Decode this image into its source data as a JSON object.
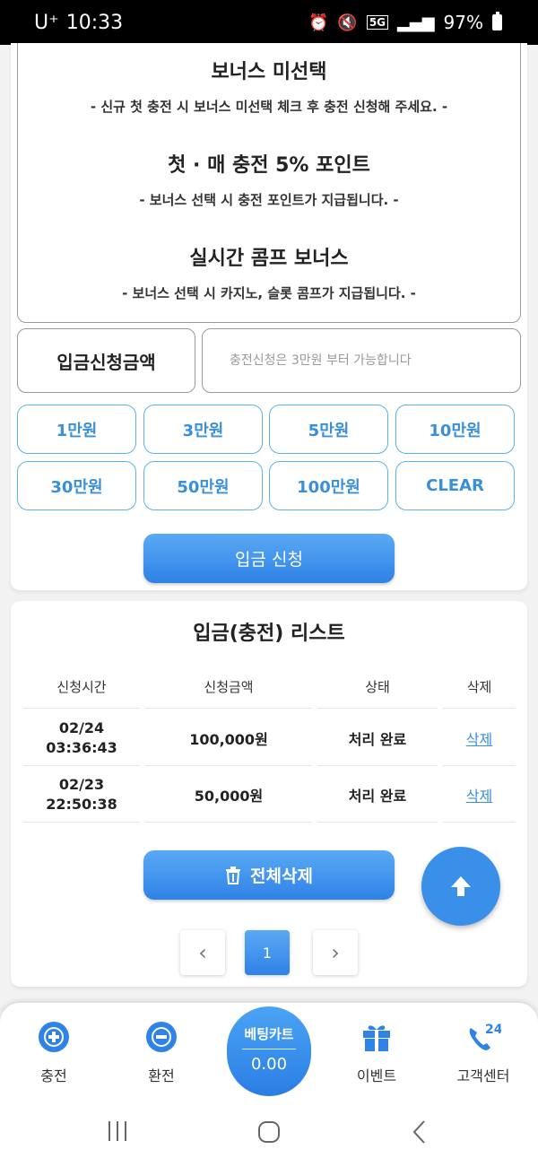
{
  "status_bar": {
    "carrier": "U⁺",
    "time": "10:33",
    "network": "5G",
    "battery": "97%"
  },
  "bonuses": [
    {
      "title": "보너스 미선택",
      "desc": "- 신규 첫 충전 시 보너스 미선택 체크 후 충전 신청해 주세요. -"
    },
    {
      "title": "첫 · 매 충전 5% 포인트",
      "desc": "- 보너스 선택 시 충전 포인트가 지급됩니다. -"
    },
    {
      "title": "실시간 콤프 보너스",
      "desc": "- 보너스 선택 시 카지노, 슬롯 콤프가 지급됩니다. -"
    }
  ],
  "deposit": {
    "label": "입금신청금액",
    "placeholder": "충전신청은 3만원 부터 가능합니다",
    "amounts": [
      "1만원",
      "3만원",
      "5만원",
      "10만원",
      "30만원",
      "50만원",
      "100만원",
      "CLEAR"
    ],
    "submit_label": "입금 신청"
  },
  "list": {
    "title": "입금(충전) 리스트",
    "headers": [
      "신청시간",
      "신청금액",
      "상태",
      "삭제"
    ],
    "rows": [
      {
        "date": "02/24",
        "time": "03:36:43",
        "amount": "100,000원",
        "status": "처리 완료",
        "delete": "삭제"
      },
      {
        "date": "02/23",
        "time": "22:50:38",
        "amount": "50,000원",
        "status": "처리 완료",
        "delete": "삭제"
      }
    ],
    "delete_all_label": "전체삭제",
    "pager": {
      "prev": "‹",
      "current": "1",
      "next": "›"
    }
  },
  "bottom_nav": {
    "items": [
      {
        "label": "충전",
        "icon": "plus-coin-icon"
      },
      {
        "label": "환전",
        "icon": "minus-coin-icon"
      },
      {
        "label": "이벤트",
        "icon": "gift-icon"
      },
      {
        "label": "고객센터",
        "icon": "phone-24-icon"
      }
    ],
    "betting_cart": {
      "label": "베팅카트",
      "value": "0.00"
    }
  },
  "phone_badge": "24",
  "colors": {
    "accent": "#2f82e6",
    "accent_light": "#5bb3ea",
    "link": "#3a8fd9"
  }
}
